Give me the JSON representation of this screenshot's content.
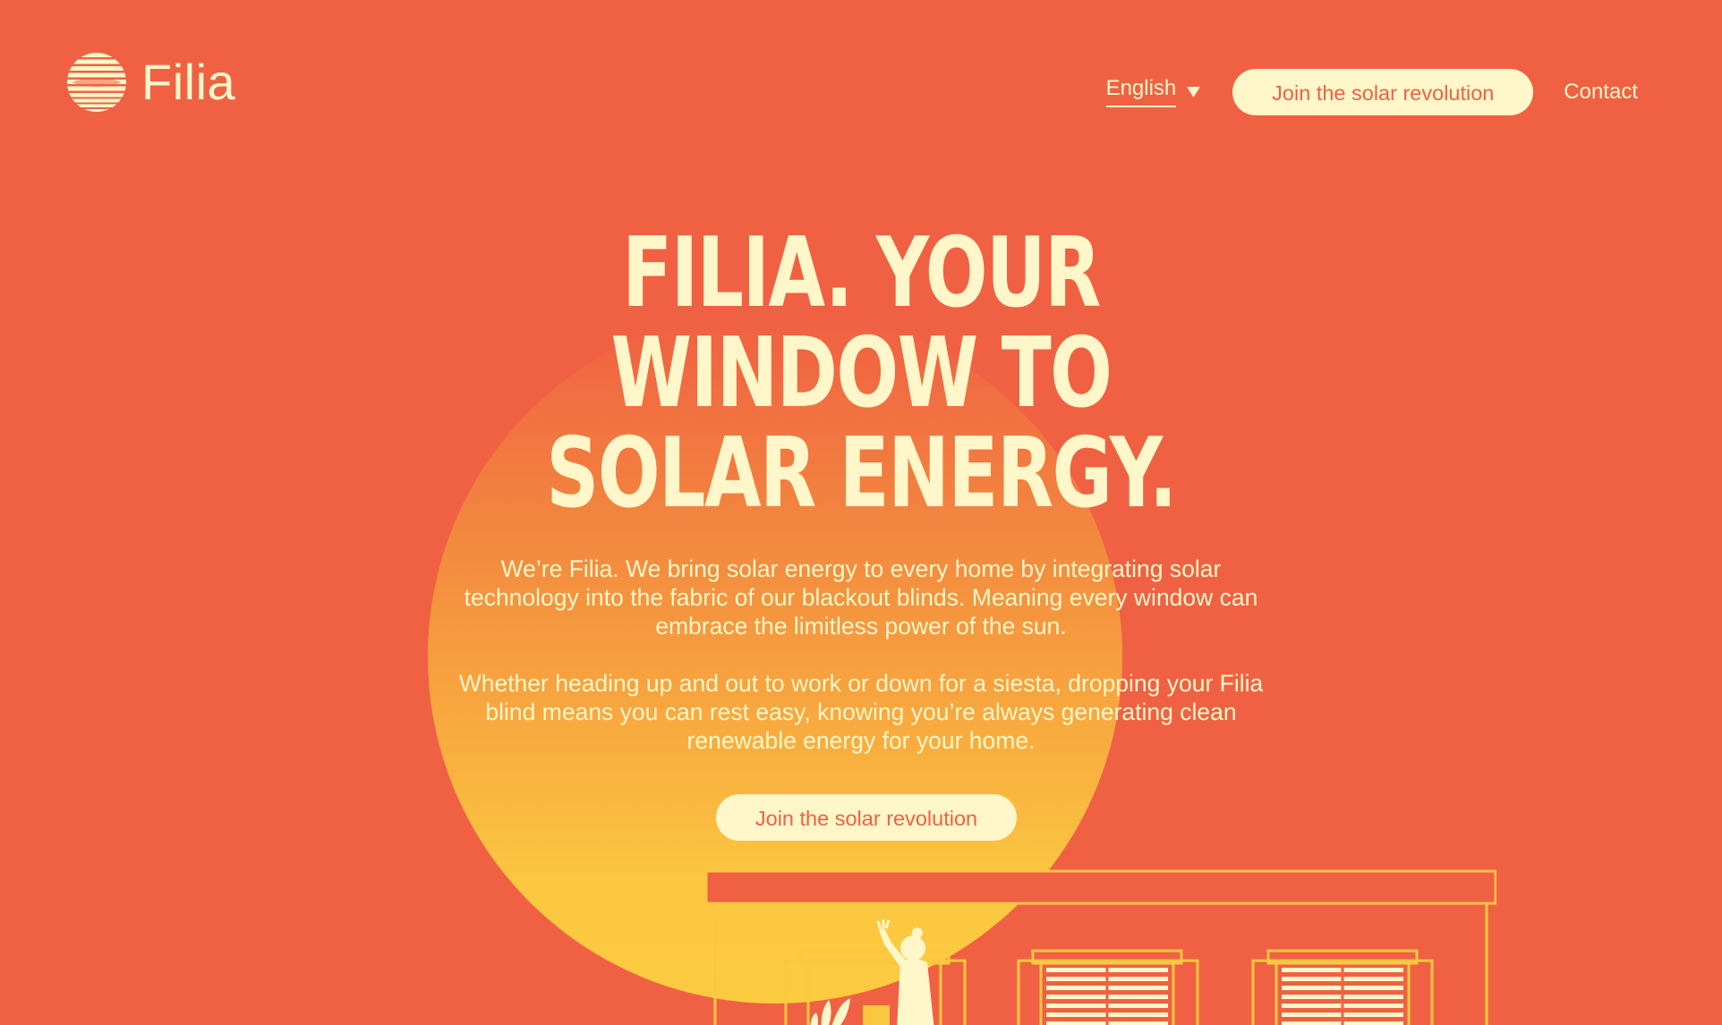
{
  "brand": {
    "name": "Filia"
  },
  "nav": {
    "language": "English",
    "cta_label": "Join the solar revolution",
    "contact_label": "Contact"
  },
  "hero": {
    "title": "FILIA. YOUR WINDOW TO SOLAR ENERGY.",
    "paragraph_1": "We’re Filia. We bring solar energy to every home by integrating solar technology into the fabric of our blackout blinds. Meaning every window can embrace the limitless power of the sun.",
    "paragraph_2": "Whether heading up and out to work or down for a siesta, dropping your Filia blind means you can rest easy, knowing you’re always generating clean renewable energy for your home.",
    "cta_label": "Join the solar revolution"
  },
  "colors": {
    "background": "#f06143",
    "cream": "#fff7c9",
    "sun_top": "#f06143",
    "sun_bottom": "#fccb40",
    "outline": "#fbc640"
  },
  "icons": {
    "logo": "striped-sun-icon",
    "language_toggle": "chevron-down-icon",
    "illustration": "house-illustration"
  }
}
